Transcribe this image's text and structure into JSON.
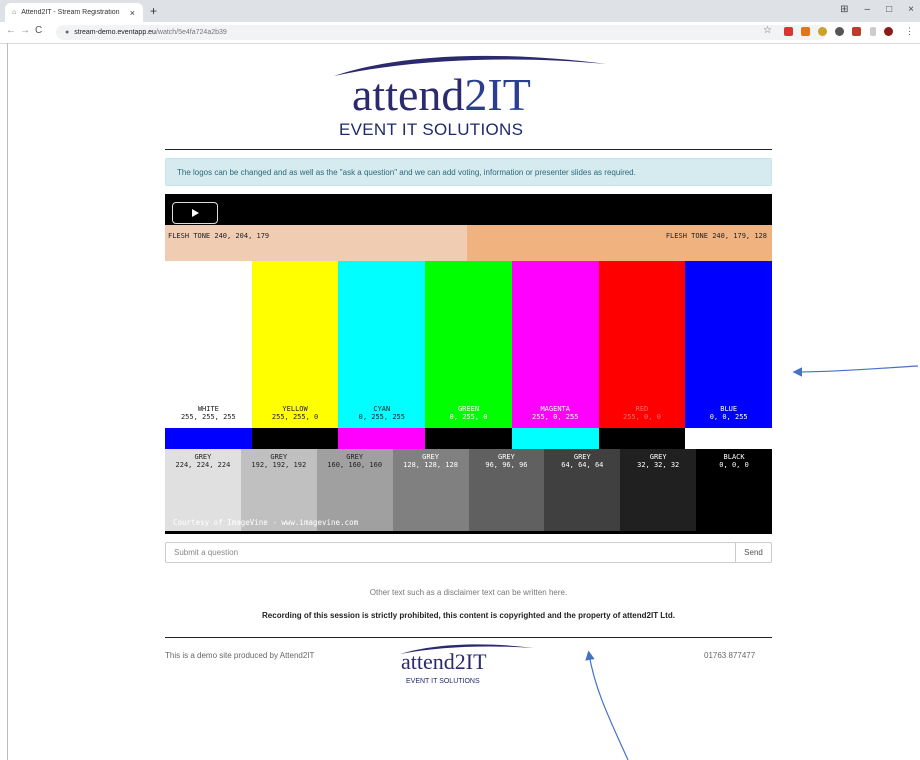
{
  "browser": {
    "tab_title": "Attend2IT - Stream Registration",
    "tab_close": "×",
    "new_tab": "+",
    "url_host": "stream-demo.eventapp.eu",
    "url_path": "/watch/5e4fa724a2b39",
    "back": "←",
    "forward": "→",
    "reload": "C",
    "lock": "🔒",
    "star": "☆",
    "window_controls": [
      "⊞",
      "–",
      "□",
      "×"
    ]
  },
  "header": {
    "logo_word_main": "attend",
    "logo_word_accent": "2IT",
    "logo_tagline": "EVENT IT SOLUTIONS"
  },
  "alert": {
    "text": "The logos can be changed and as well as the \"ask a question\" and we can add voting, information or presenter slides as required."
  },
  "video": {
    "flesh_left": "FLESH TONE 240, 204, 179",
    "flesh_right": "FLESH TONE 240, 179, 128",
    "bars": [
      {
        "name": "WHITE",
        "value": "255, 255, 255",
        "color": "#ffffff",
        "text": "#222222"
      },
      {
        "name": "YELLOW",
        "value": "255, 255, 0",
        "color": "#ffff00",
        "text": "#222222"
      },
      {
        "name": "CYAN",
        "value": "0, 255, 255",
        "color": "#00ffff",
        "text": "#222222"
      },
      {
        "name": "GREEN",
        "value": "0, 255, 0",
        "color": "#00ff00",
        "text": "#ffffff"
      },
      {
        "name": "MAGENTA",
        "value": "255, 0, 255",
        "color": "#ff00ff",
        "text": "#ffffff"
      },
      {
        "name": "RED",
        "value": "255, 0, 0",
        "color": "#ff0000",
        "text": "#ff6a6a"
      },
      {
        "name": "BLUE",
        "value": "0, 0, 255",
        "color": "#0000ff",
        "text": "#ffffff"
      }
    ],
    "reverse": [
      "#0000ff",
      "#000000",
      "#ff00ff",
      "#000000",
      "#00ffff",
      "#000000",
      "#ffffff"
    ],
    "greys": [
      {
        "name": "GREY",
        "value": "224, 224, 224",
        "color": "#e0e0e0",
        "text": "#222222"
      },
      {
        "name": "GREY",
        "value": "192, 192, 192",
        "color": "#c0c0c0",
        "text": "#222222"
      },
      {
        "name": "GREY",
        "value": "160, 160, 160",
        "color": "#a0a0a0",
        "text": "#222222"
      },
      {
        "name": "GREY",
        "value": "128, 128, 128",
        "color": "#808080",
        "text": "#ffffff"
      },
      {
        "name": "GREY",
        "value": "96, 96, 96",
        "color": "#606060",
        "text": "#ffffff"
      },
      {
        "name": "GREY",
        "value": "64, 64, 64",
        "color": "#404040",
        "text": "#ffffff"
      },
      {
        "name": "GREY",
        "value": "32, 32, 32",
        "color": "#202020",
        "text": "#ffffff"
      },
      {
        "name": "BLACK",
        "value": "0, 0, 0",
        "color": "#000000",
        "text": "#ffffff"
      }
    ],
    "courtesy": "Courtesy of ImageVine - www.imagevine.com"
  },
  "question": {
    "placeholder": "Submit a question",
    "send_label": "Send"
  },
  "disclaimer": "Other text such as a disclaimer text can be written here.",
  "recording_notice": "Recording of this session is strictly prohibited, this content is copyrighted and the property of attend2IT Ltd.",
  "footer": {
    "left_text": "This is a demo site produced by Attend2IT",
    "right_text": "01763 877477",
    "logo_word_main": "attend",
    "logo_word_accent": "2IT",
    "logo_tagline": "EVENT IT SOLUTIONS"
  },
  "colors": {
    "brand_navy": "#2b2a6e",
    "alert_bg": "#d6ebf0",
    "arrow": "#4472c4"
  }
}
